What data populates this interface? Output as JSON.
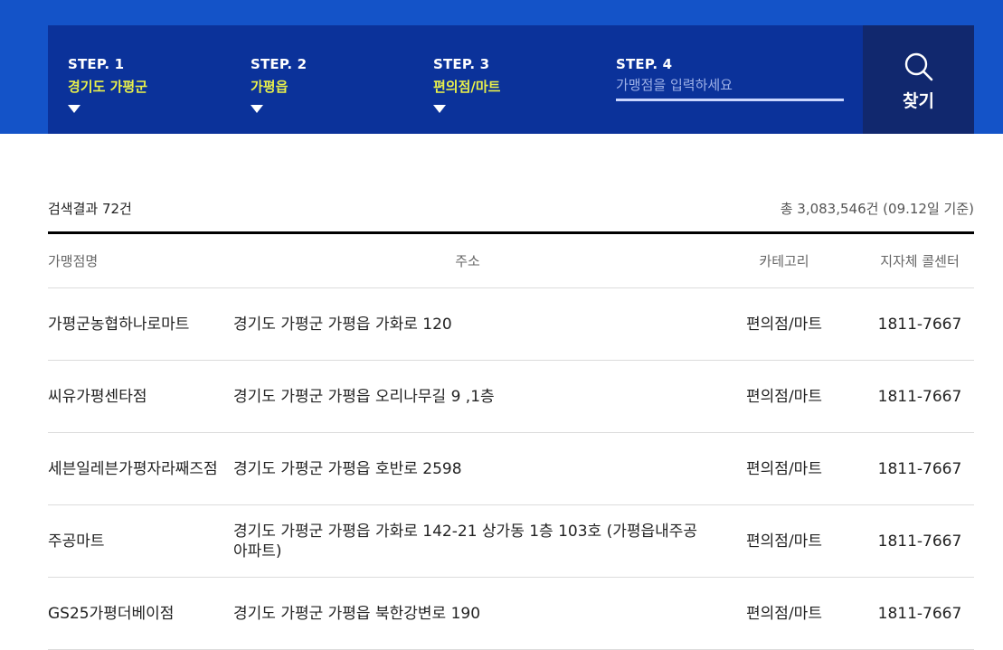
{
  "steps": [
    {
      "title": "STEP. 1",
      "value": "경기도 가평군"
    },
    {
      "title": "STEP. 2",
      "value": "가평읍"
    },
    {
      "title": "STEP. 3",
      "value": "편의점/마트"
    },
    {
      "title": "STEP. 4",
      "placeholder": "가맹점을 입력하세요"
    }
  ],
  "search_button": {
    "label": "찾기",
    "icon": "search-icon"
  },
  "summary": {
    "result_count": "검색결과 72건",
    "total": "총 3,083,546건 (09.12일 기준)"
  },
  "table": {
    "headers": [
      "가맹점명",
      "주소",
      "카테고리",
      "지자체 콜센터"
    ],
    "rows": [
      {
        "name": "가평군농협하나로마트",
        "address": "경기도 가평군 가평읍 가화로 120",
        "category": "편의점/마트",
        "tel": "1811-7667"
      },
      {
        "name": "씨유가평센타점",
        "address": "경기도 가평군 가평읍 오리나무길 9 ,1층",
        "category": "편의점/마트",
        "tel": "1811-7667"
      },
      {
        "name": "세븐일레븐가평자라째즈점",
        "address": "경기도 가평군 가평읍 호반로 2598",
        "category": "편의점/마트",
        "tel": "1811-7667"
      },
      {
        "name": "주공마트",
        "address": "경기도 가평군 가평읍 가화로 142-21 상가동 1층 103호 (가평읍내주공아파트)",
        "category": "편의점/마트",
        "tel": "1811-7667"
      },
      {
        "name": "GS25가평더베이점",
        "address": "경기도 가평군 가평읍 북한강변로 190",
        "category": "편의점/마트",
        "tel": "1811-7667"
      }
    ]
  },
  "colors": {
    "band": "#1453c8",
    "panel": "#0b329a",
    "button": "#11286e",
    "highlight": "#e9f04a"
  }
}
